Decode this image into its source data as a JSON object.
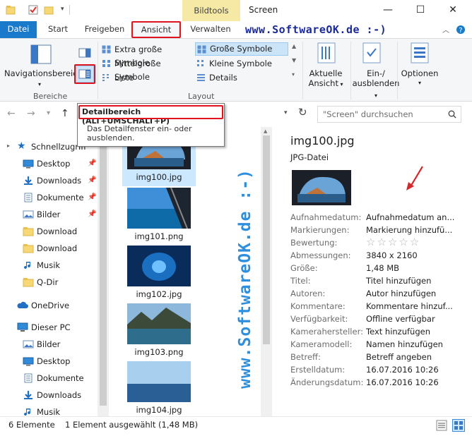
{
  "window": {
    "title": "Screen",
    "contextual_tab": "Bildtools",
    "minimize": "—",
    "maximize": "☐",
    "close": "✕"
  },
  "ribbon_tabs": [
    {
      "label": "Datei"
    },
    {
      "label": "Start"
    },
    {
      "label": "Freigeben"
    },
    {
      "label": "Ansicht"
    },
    {
      "label": "Verwalten"
    }
  ],
  "watermark": {
    "top": "www.SoftwareOK.de :-)",
    "vertical": "www.SoftwareOK.de :-)"
  },
  "ribbon": {
    "panes": {
      "navigation_label": "Navigationsbereich",
      "group_label": "Bereiche"
    },
    "layout": {
      "items": [
        "Extra große Symbole",
        "Große Symbole",
        "Mittelgroße Symbole",
        "Kleine Symbole",
        "Liste",
        "Details"
      ],
      "selected": "Große Symbole",
      "group_label": "Layout"
    },
    "current_view": {
      "line1": "Aktuelle",
      "line2": "Ansicht"
    },
    "show_hide": {
      "line1": "Ein-/",
      "line2": "ausblenden"
    },
    "options": {
      "label": "Optionen"
    }
  },
  "address": {
    "search_placeholder": "\"Screen\" durchsuchen"
  },
  "tooltip": {
    "title": "Detailbereich (ALT+UMSCHALT+P)",
    "text": "Das Detailfenster ein- oder ausblenden."
  },
  "navigation": {
    "quick_access": "Schnellzugriff",
    "quick_items": [
      {
        "label": "Desktop",
        "icon": "desktop-icon",
        "pinned": true
      },
      {
        "label": "Downloads",
        "icon": "download-arrow-icon",
        "pinned": true
      },
      {
        "label": "Dokumente",
        "icon": "document-icon",
        "pinned": true
      },
      {
        "label": "Bilder",
        "icon": "pictures-icon",
        "pinned": true
      },
      {
        "label": "Download",
        "icon": "folder-icon",
        "pinned": false
      },
      {
        "label": "Download",
        "icon": "folder-icon",
        "pinned": false
      },
      {
        "label": "Musik",
        "icon": "music-icon",
        "pinned": false
      },
      {
        "label": "Q-Dir",
        "icon": "folder-icon",
        "pinned": false
      }
    ],
    "onedrive": "OneDrive",
    "this_pc": "Dieser PC",
    "pc_items": [
      {
        "label": "Bilder",
        "icon": "pictures-icon"
      },
      {
        "label": "Desktop",
        "icon": "desktop-icon"
      },
      {
        "label": "Dokumente",
        "icon": "document-icon"
      },
      {
        "label": "Downloads",
        "icon": "download-arrow-icon"
      },
      {
        "label": "Musik",
        "icon": "music-icon"
      }
    ]
  },
  "files": [
    {
      "name": "img100.jpg",
      "selected": true
    },
    {
      "name": "img101.png",
      "selected": false
    },
    {
      "name": "img102.jpg",
      "selected": false
    },
    {
      "name": "img103.png",
      "selected": false
    },
    {
      "name": "img104.jpg",
      "selected": false
    }
  ],
  "details": {
    "filename": "img100.jpg",
    "filetype": "JPG-Datei",
    "properties": [
      {
        "label": "Aufnahmedatum:",
        "value": "Aufnahmedatum an..."
      },
      {
        "label": "Markierungen:",
        "value": "Markierung hinzufü..."
      },
      {
        "label": "Bewertung:",
        "value": "☆☆☆☆☆"
      },
      {
        "label": "Abmessungen:",
        "value": "3840 x 2160"
      },
      {
        "label": "Größe:",
        "value": "1,48 MB"
      },
      {
        "label": "Titel:",
        "value": "Titel hinzufügen"
      },
      {
        "label": "Autoren:",
        "value": "Autor hinzufügen"
      },
      {
        "label": "Kommentare:",
        "value": "Kommentare hinzuf..."
      },
      {
        "label": "Verfügbarkeit:",
        "value": "Offline verfügbar"
      },
      {
        "label": "Kamerahersteller:",
        "value": "Text hinzufügen"
      },
      {
        "label": "Kameramodell:",
        "value": "Namen hinzufügen"
      },
      {
        "label": "Betreff:",
        "value": "Betreff angeben"
      },
      {
        "label": "Erstelldatum:",
        "value": "16.07.2016 10:26"
      },
      {
        "label": "Änderungsdatum:",
        "value": "16.07.2016 10:26"
      }
    ]
  },
  "status": {
    "count": "6 Elemente",
    "selection": "1 Element ausgewählt (1,48 MB)"
  },
  "colors": {
    "accent": "#1979ca",
    "highlight_red": "#e0141e",
    "selection": "#cce8ff",
    "watermark_blue": "#2e8fde",
    "contextual_tab": "#f6e9a6"
  }
}
